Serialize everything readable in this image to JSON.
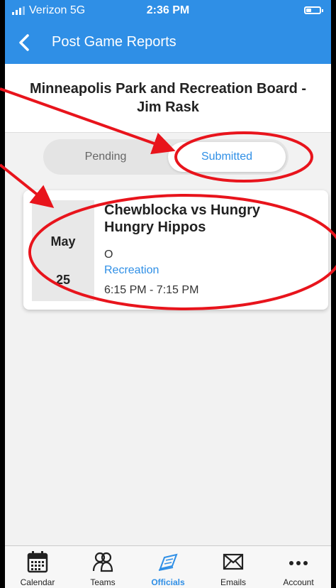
{
  "status_bar": {
    "carrier": "Verizon 5G",
    "time": "2:36 PM"
  },
  "header": {
    "title": "Post Game Reports",
    "back_icon": "chevron-left-icon"
  },
  "organization": {
    "line1": "Minneapolis Park and Recreation Board -",
    "line2": "Jim Rask"
  },
  "segments": {
    "pending": "Pending",
    "submitted": "Submitted",
    "selected": "submitted"
  },
  "games": [
    {
      "month": "May",
      "day": "25",
      "title_line1": "Chewblocka vs Hungry",
      "title_line2": "Hungry Hippos",
      "subtitle": "O",
      "level": "Recreation",
      "time": "6:15 PM - 7:15 PM"
    }
  ],
  "tabbar": {
    "items": [
      {
        "label": "Calendar",
        "icon": "calendar-icon"
      },
      {
        "label": "Teams",
        "icon": "people-icon"
      },
      {
        "label": "Officials",
        "icon": "whistle-icon"
      },
      {
        "label": "Emails",
        "icon": "envelope-icon"
      },
      {
        "label": "Account",
        "icon": "more-icon"
      }
    ],
    "active": "Officials"
  },
  "colors": {
    "accent": "#2f8fe6",
    "annotation": "#e8141c"
  }
}
